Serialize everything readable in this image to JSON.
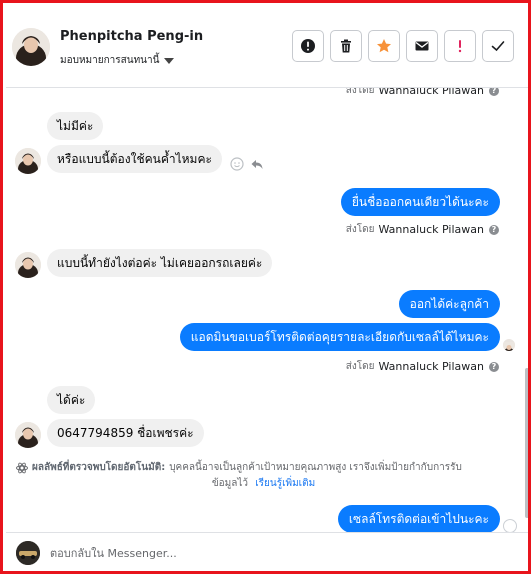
{
  "header": {
    "contact_name": "Phenpitcha Peng-in",
    "assign_label": "มอบหมายการสนทนานี้",
    "actions": [
      {
        "icon": "info-icon",
        "color": "#1c1e21"
      },
      {
        "icon": "trash-icon",
        "color": "#1c1e21"
      },
      {
        "icon": "star-icon",
        "color": "#f7923a"
      },
      {
        "icon": "mail-icon",
        "color": "#1c1e21"
      },
      {
        "icon": "exclamation-icon",
        "color": "#e0245e"
      },
      {
        "icon": "check-icon",
        "color": "#1c1e21"
      }
    ]
  },
  "colors": {
    "frame_border": "#e8141c",
    "outgoing_bubble": "#0a7cff",
    "incoming_bubble": "#f0f0f0",
    "link": "#1877f2"
  },
  "chat": {
    "sent_by_label": "ส่งโดย",
    "agent_name": "Wannaluck Pilawan",
    "messages": [
      {
        "direction": "in",
        "text": "ไม่มีค่ะ"
      },
      {
        "direction": "in",
        "text": "หรือแบบนี้ต้องใช้คนค้ำไหมคะ"
      },
      {
        "direction": "out",
        "text": "ยื่นชื่อออกคนเดียวได้นะคะ"
      },
      {
        "direction": "in",
        "text": "แบบนี้ทำยังไงต่อค่ะ ไม่เคยออกรถเลยค่ะ"
      },
      {
        "direction": "out",
        "text": "ออกได้ค่ะลูกค้า"
      },
      {
        "direction": "out",
        "text": "แอดมินขอเบอร์โทรติดต่อคุยรายละเอียดกับเซลล์ได้ไหมคะ"
      },
      {
        "direction": "in",
        "text": "ได้ค่ะ"
      },
      {
        "direction": "in",
        "text": "0647794859 ชื่อเพชรค่ะ"
      },
      {
        "direction": "out",
        "text": "เซลล์โทรติดต่อเข้าไปนะคะ"
      }
    ],
    "ai_notice": {
      "label": "ผลลัพธ์ที่ตรวจพบโดยอัตโนมัติ:",
      "body_line1": "บุคคลนี้อาจเป็นลูกค้าเป้าหมายคุณภาพสูง เราจึงเพิ่มป้ายกำกับการรับ",
      "body_line2": "ข้อมูลไว้",
      "link": "เรียนรู้เพิ่มเติม"
    }
  },
  "composer": {
    "placeholder": "ตอบกลับใน Messenger..."
  }
}
